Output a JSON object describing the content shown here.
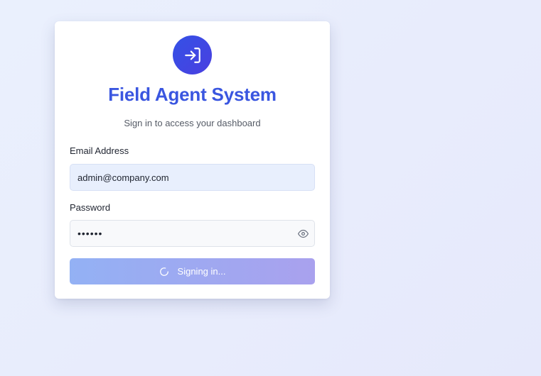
{
  "header": {
    "title": "Field Agent System",
    "subtitle": "Sign in to access your dashboard"
  },
  "form": {
    "email": {
      "label": "Email Address",
      "value": "admin@company.com"
    },
    "password": {
      "label": "Password",
      "value": "••••••"
    },
    "submit": {
      "label": "Signing in...",
      "state": "loading"
    }
  },
  "icons": {
    "logo": "sign-in-icon",
    "password_toggle": "eye-icon",
    "loading": "spinner-icon"
  },
  "colors": {
    "accent": "#3a56e0",
    "logo_gradient_start": "#3451e6",
    "logo_gradient_end": "#4a3fe0",
    "button_gradient_start": "#93b1f4",
    "button_gradient_end": "#a9a1ee"
  }
}
